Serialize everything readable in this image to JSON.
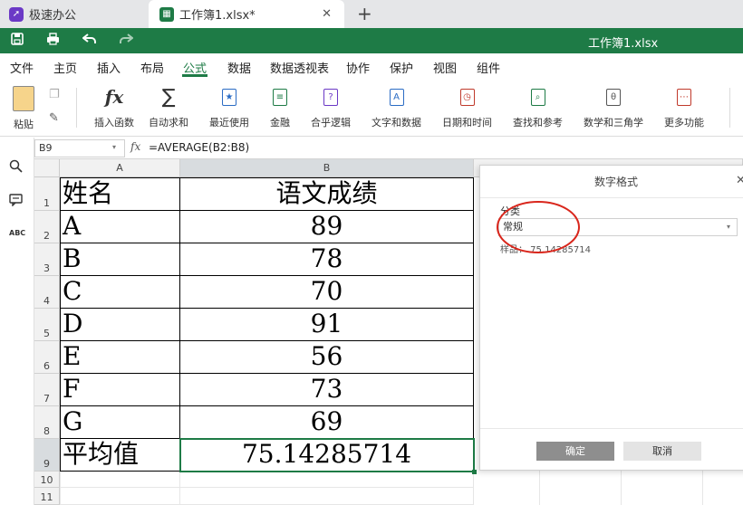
{
  "tabs": {
    "tab1": {
      "label": "极速办公"
    },
    "tab2": {
      "label": "工作簿1.xlsx*"
    }
  },
  "window": {
    "title": "工作簿1.xlsx"
  },
  "menu": {
    "items": [
      "文件",
      "主页",
      "插入",
      "布局",
      "公式",
      "数据",
      "数据透视表",
      "协作",
      "保护",
      "视图",
      "组件"
    ],
    "active": "公式"
  },
  "ribbon": {
    "paste": "粘贴",
    "insert_function": "插入函数",
    "autosum": "自动求和",
    "recent": "最近使用",
    "financial": "金融",
    "logical": "合乎逻辑",
    "text_data": "文字和数据",
    "date_time": "日期和时间",
    "lookup": "查找和参考",
    "math_trig": "数学和三角学",
    "more": "更多功能"
  },
  "formula_bar": {
    "name_box": "B9",
    "fx": "fx",
    "formula": "=AVERAGE(B2:B8)"
  },
  "sheet": {
    "columns": [
      "A",
      "B"
    ],
    "rows": [
      {
        "num": "1",
        "a": "姓名",
        "b": "语文成绩"
      },
      {
        "num": "2",
        "a": "A",
        "b": "89"
      },
      {
        "num": "3",
        "a": "B",
        "b": "78"
      },
      {
        "num": "4",
        "a": "C",
        "b": "70"
      },
      {
        "num": "5",
        "a": "D",
        "b": "91"
      },
      {
        "num": "6",
        "a": "E",
        "b": "56"
      },
      {
        "num": "7",
        "a": "F",
        "b": "73"
      },
      {
        "num": "8",
        "a": "G",
        "b": "69"
      },
      {
        "num": "9",
        "a": "平均值",
        "b": "75.14285714"
      },
      {
        "num": "10",
        "a": "",
        "b": ""
      },
      {
        "num": "11",
        "a": "",
        "b": ""
      }
    ],
    "selected_cell": "B9"
  },
  "number_format_panel": {
    "title": "数字格式",
    "category_label": "分类",
    "category_value": "常规",
    "sample": "样品： 75.14285714",
    "ok": "确定",
    "cancel": "取消"
  },
  "colors": {
    "brand_green": "#1e7b46",
    "app_purple": "#6b39c6",
    "annotation_red": "#d9261c"
  }
}
